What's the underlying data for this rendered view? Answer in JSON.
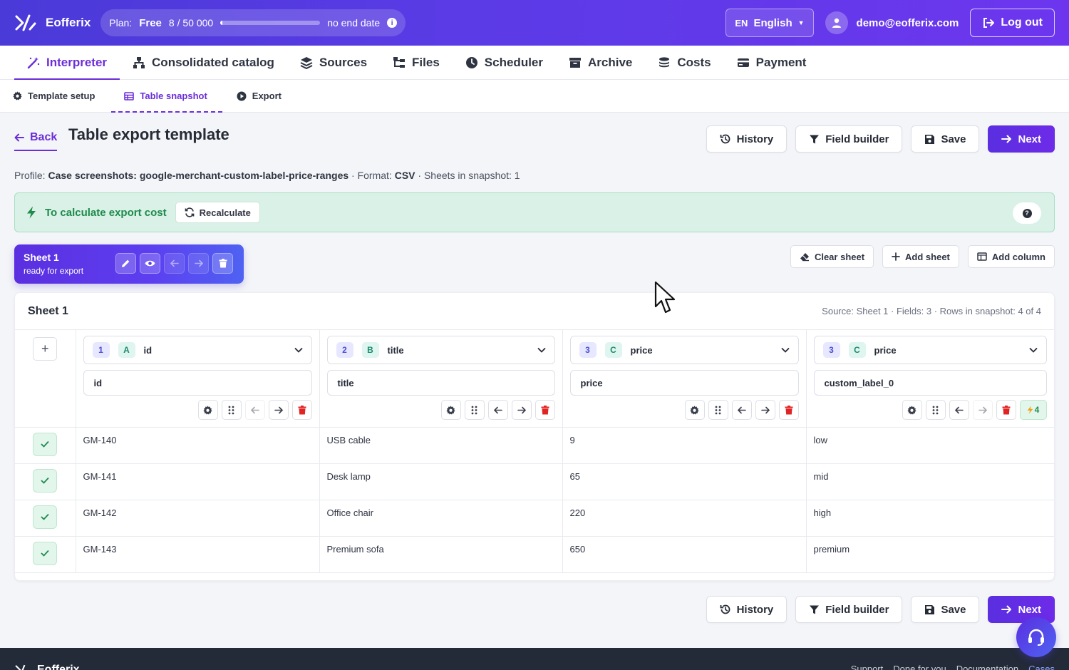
{
  "app": {
    "name": "Eofferix"
  },
  "plan": {
    "label": "Plan:",
    "tier": "Free",
    "usage": "8 / 50 000",
    "usage_fraction": 0.00016,
    "expiry": "no end date"
  },
  "language": {
    "code": "EN",
    "name": "English"
  },
  "user": {
    "email": "demo@eofferix.com"
  },
  "logout_label": "Log out",
  "main_nav": [
    {
      "label": "Interpreter",
      "icon": "magic-wand-icon",
      "active": true
    },
    {
      "label": "Consolidated catalog",
      "icon": "sitemap-icon"
    },
    {
      "label": "Sources",
      "icon": "layers-icon"
    },
    {
      "label": "Files",
      "icon": "folder-tree-icon"
    },
    {
      "label": "Scheduler",
      "icon": "clock-icon"
    },
    {
      "label": "Archive",
      "icon": "archive-icon"
    },
    {
      "label": "Costs",
      "icon": "coins-icon"
    },
    {
      "label": "Payment",
      "icon": "credit-card-icon"
    }
  ],
  "sub_nav": [
    {
      "label": "Template setup",
      "icon": "gear-icon"
    },
    {
      "label": "Table snapshot",
      "icon": "table-icon",
      "active": true
    },
    {
      "label": "Export",
      "icon": "play-circle-icon"
    }
  ],
  "back_label": "Back",
  "page_title": "Table export template",
  "actions": {
    "history": "History",
    "field_builder": "Field builder",
    "save": "Save",
    "next": "Next"
  },
  "profile": {
    "profile_label": "Profile:",
    "profile_name": "Case screenshots: google-merchant-custom-label-price-ranges",
    "format_label": "· Format:",
    "format": "CSV",
    "sheets_text": "· Sheets in snapshot: 1"
  },
  "cost_banner": {
    "label": "To calculate export cost",
    "recalculate": "Recalculate",
    "help": "?"
  },
  "sheet_card": {
    "name": "Sheet 1",
    "status": "ready for export"
  },
  "sheet_actions": {
    "clear": "Clear sheet",
    "add_sheet": "Add sheet",
    "add_column": "Add column"
  },
  "table": {
    "title": "Sheet 1",
    "meta": "Source: Sheet 1 · Fields: 3 · Rows in snapshot: 4 of 4",
    "columns": [
      {
        "num": "1",
        "letter": "A",
        "field": "id",
        "name": "id"
      },
      {
        "num": "2",
        "letter": "B",
        "field": "title",
        "name": "title"
      },
      {
        "num": "3",
        "letter": "C",
        "field": "price",
        "name": "price"
      },
      {
        "num": "3",
        "letter": "C",
        "field": "price",
        "name": "custom_label_0",
        "rules": "4"
      }
    ],
    "rows": [
      [
        "GM-140",
        "USB cable",
        "9",
        "low"
      ],
      [
        "GM-141",
        "Desk lamp",
        "65",
        "mid"
      ],
      [
        "GM-142",
        "Office chair",
        "220",
        "high"
      ],
      [
        "GM-143",
        "Premium sofa",
        "650",
        "premium"
      ]
    ]
  },
  "footer": {
    "links": [
      "Support",
      "Done for you",
      "Documentation",
      "Cases"
    ]
  },
  "colors": {
    "accent": "#6b2ed8",
    "success": "#1e8a4c",
    "danger": "#e02424"
  }
}
